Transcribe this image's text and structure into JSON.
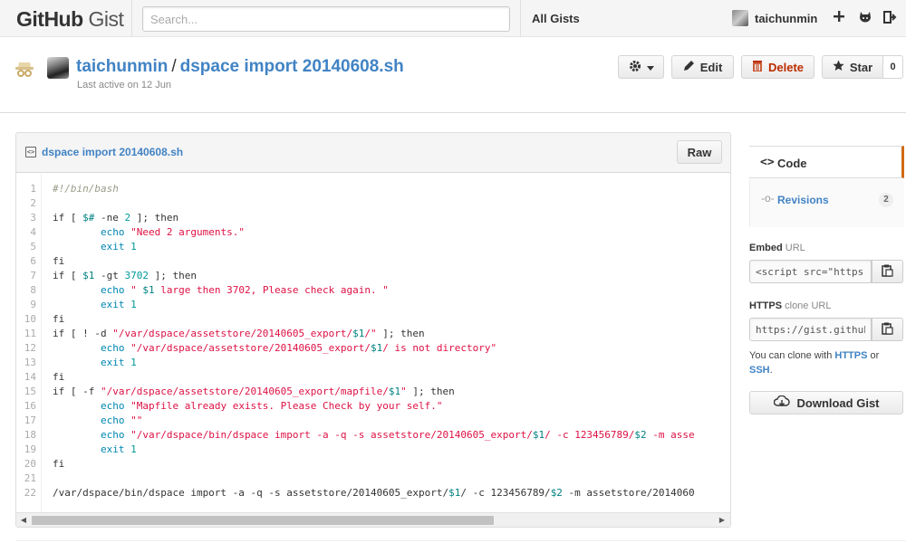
{
  "header": {
    "logo_main": "GitHub",
    "logo_sub": "Gist",
    "search_placeholder": "Search...",
    "all_gists": "All Gists",
    "username": "taichunmin",
    "icons": [
      "plus-icon",
      "octocat-icon",
      "sign-out-icon"
    ]
  },
  "gist": {
    "owner": "taichunmin",
    "separator": "/",
    "name": "dspace import 20140608.sh",
    "last_active": "Last active on 12 Jun",
    "edit_label": "Edit",
    "delete_label": "Delete",
    "star_label": "Star",
    "star_count": "0"
  },
  "file": {
    "filename": "dspace import 20140608.sh",
    "raw_label": "Raw",
    "lines": [
      {
        "n": "1",
        "t": "#!/bin/bash"
      },
      {
        "n": "2",
        "t": ""
      },
      {
        "n": "3",
        "t": "if [ $# -ne 2 ]; then"
      },
      {
        "n": "4",
        "t": "        echo \"Need 2 arguments.\""
      },
      {
        "n": "5",
        "t": "        exit 1"
      },
      {
        "n": "6",
        "t": "fi"
      },
      {
        "n": "7",
        "t": "if [ $1 -gt 3702 ]; then"
      },
      {
        "n": "8",
        "t": "        echo \" $1 large then 3702, Please check again. \""
      },
      {
        "n": "9",
        "t": "        exit 1"
      },
      {
        "n": "10",
        "t": "fi"
      },
      {
        "n": "11",
        "t": "if [ ! -d \"/var/dspace/assetstore/20140605_export/$1/\" ]; then"
      },
      {
        "n": "12",
        "t": "        echo \"/var/dspace/assetstore/20140605_export/$1/ is not directory\""
      },
      {
        "n": "13",
        "t": "        exit 1"
      },
      {
        "n": "14",
        "t": "fi"
      },
      {
        "n": "15",
        "t": "if [ -f \"/var/dspace/assetstore/20140605_export/mapfile/$1\" ]; then"
      },
      {
        "n": "16",
        "t": "        echo \"Mapfile already exists. Please Check by your self.\""
      },
      {
        "n": "17",
        "t": "        echo \"\""
      },
      {
        "n": "18",
        "t": "        echo \"/var/dspace/bin/dspace import -a -q -s assetstore/20140605_export/$1/ -c 123456789/$2 -m asse"
      },
      {
        "n": "19",
        "t": "        exit 1"
      },
      {
        "n": "20",
        "t": "fi"
      },
      {
        "n": "21",
        "t": ""
      },
      {
        "n": "22",
        "t": "/var/dspace/bin/dspace import -a -q -s assetstore/20140605_export/$1/ -c 123456789/$2 -m assetstore/2014060"
      }
    ]
  },
  "sidebar": {
    "code_tab": "Code",
    "revisions_tab": "Revisions",
    "revisions_count": "2",
    "embed_label": "Embed",
    "embed_sub": "URL",
    "embed_value": "<script src=\"https://gist.github.com",
    "https_label": "HTTPS",
    "https_sub": "clone URL",
    "https_value": "https://gist.github.com/",
    "clone_note_pre": "You can clone with ",
    "clone_https": "HTTPS",
    "clone_or": " or",
    "clone_ssh": "SSH",
    "clone_end": ".",
    "download_label": "Download Gist"
  }
}
